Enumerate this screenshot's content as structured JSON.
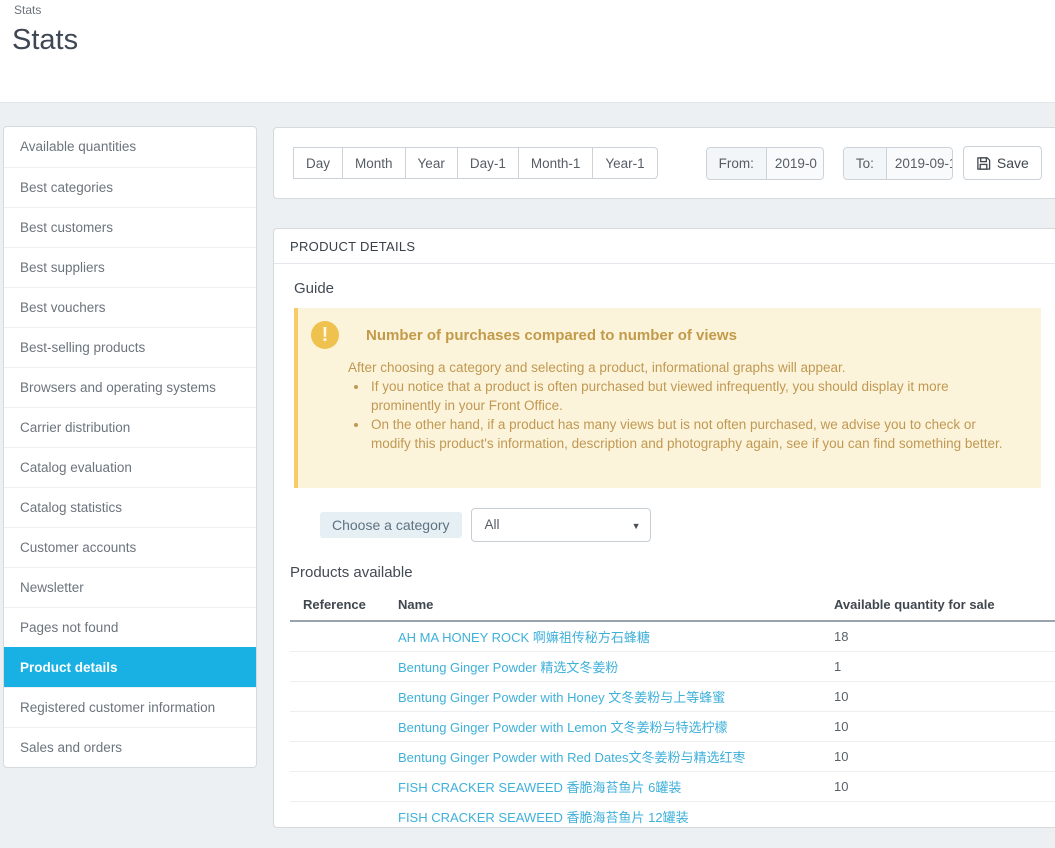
{
  "page": {
    "breadcrumb": "Stats",
    "title": "Stats"
  },
  "sidebar": {
    "items": [
      {
        "label": "Available quantities",
        "active": false
      },
      {
        "label": "Best categories",
        "active": false
      },
      {
        "label": "Best customers",
        "active": false
      },
      {
        "label": "Best suppliers",
        "active": false
      },
      {
        "label": "Best vouchers",
        "active": false
      },
      {
        "label": "Best-selling products",
        "active": false
      },
      {
        "label": "Browsers and operating systems",
        "active": false
      },
      {
        "label": "Carrier distribution",
        "active": false
      },
      {
        "label": "Catalog evaluation",
        "active": false
      },
      {
        "label": "Catalog statistics",
        "active": false
      },
      {
        "label": "Customer accounts",
        "active": false
      },
      {
        "label": "Newsletter",
        "active": false
      },
      {
        "label": "Pages not found",
        "active": false
      },
      {
        "label": "Product details",
        "active": true
      },
      {
        "label": "Registered customer information",
        "active": false
      },
      {
        "label": "Sales and orders",
        "active": false
      }
    ]
  },
  "toolbar": {
    "periods": [
      "Day",
      "Month",
      "Year",
      "Day-1",
      "Month-1",
      "Year-1"
    ],
    "from_label": "From:",
    "from_value": "2019-0",
    "to_label": "To:",
    "to_value": "2019-09-1",
    "save_label": "Save"
  },
  "panel": {
    "title": "PRODUCT DETAILS",
    "guide_label": "Guide",
    "notice": {
      "title": "Number of purchases compared to number of views",
      "intro": "After choosing a category and selecting a product, informational graphs will appear.",
      "bullets": [
        "If you notice that a product is often purchased but viewed infrequently, you should display it more prominently in your Front Office.",
        "On the other hand, if a product has many views but is not often purchased, we advise you to check or modify this product's information, description and photography again, see if you can find something better."
      ]
    },
    "category": {
      "label": "Choose a category",
      "selected": "All"
    },
    "products": {
      "title": "Products available",
      "columns": [
        "Reference",
        "Name",
        "Available quantity for sale"
      ],
      "rows": [
        {
          "reference": "",
          "name": "AH MA HONEY ROCK 啊嫲祖传秘方石蜂糖",
          "qty": "18"
        },
        {
          "reference": "",
          "name": "Bentung Ginger Powder 精选文冬姜粉",
          "qty": "1"
        },
        {
          "reference": "",
          "name": "Bentung Ginger Powder with Honey 文冬姜粉与上等蜂蜜",
          "qty": "10"
        },
        {
          "reference": "",
          "name": "Bentung Ginger Powder with Lemon 文冬姜粉与特选柠檬",
          "qty": "10"
        },
        {
          "reference": "",
          "name": "Bentung Ginger Powder with Red Dates文冬姜粉与精选红枣",
          "qty": "10"
        },
        {
          "reference": "",
          "name": "FISH CRACKER SEAWEED 香脆海苔鱼片 6罐装",
          "qty": "10"
        },
        {
          "reference": "",
          "name": "FISH CRACKER SEAWEED 香脆海苔鱼片 12罐装",
          "qty": ""
        }
      ]
    }
  },
  "icons": {
    "save": "floppy-disk",
    "notice_glyph": "!",
    "caret_glyph": "▼"
  },
  "colors": {
    "accent_active": "#19b1e3",
    "link": "#3fb0d9",
    "warning_bg": "#fcf4da",
    "warning_border": "#f5cc66",
    "warning_text": "#c09853",
    "warning_icon": "#efc14f"
  }
}
